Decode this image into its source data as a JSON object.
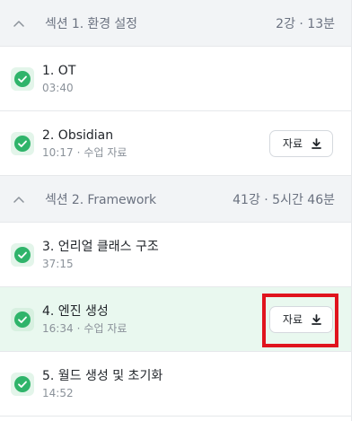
{
  "sections": [
    {
      "title": "섹션 1. 환경 설정",
      "meta": "2강 · 13분",
      "lessons": [
        {
          "name": "1. OT",
          "duration": "03:40"
        },
        {
          "name": "2. Obsidian",
          "duration": "10:17",
          "extra": "수업 자료",
          "resource_label": "자료"
        }
      ]
    },
    {
      "title": "섹션 2. Framework",
      "meta": "41강 · 5시간 46분",
      "lessons": [
        {
          "name": "3. 언리얼 클래스 구조",
          "duration": "37:15"
        },
        {
          "name": "4. 엔진 생성",
          "duration": "16:34",
          "extra": "수업 자료",
          "resource_label": "자료"
        },
        {
          "name": "5. 월드 생성 및 초기화",
          "duration": "14:52"
        }
      ]
    }
  ],
  "colors": {
    "check_green": "#2fb46a",
    "active_row_bg": "#e9f8ef",
    "section_bg": "#f2f4f6",
    "highlight_red": "#e0141e"
  },
  "icons": {
    "section_toggle": "chevron-up-icon",
    "completed": "check-circle-icon",
    "download": "download-icon"
  }
}
